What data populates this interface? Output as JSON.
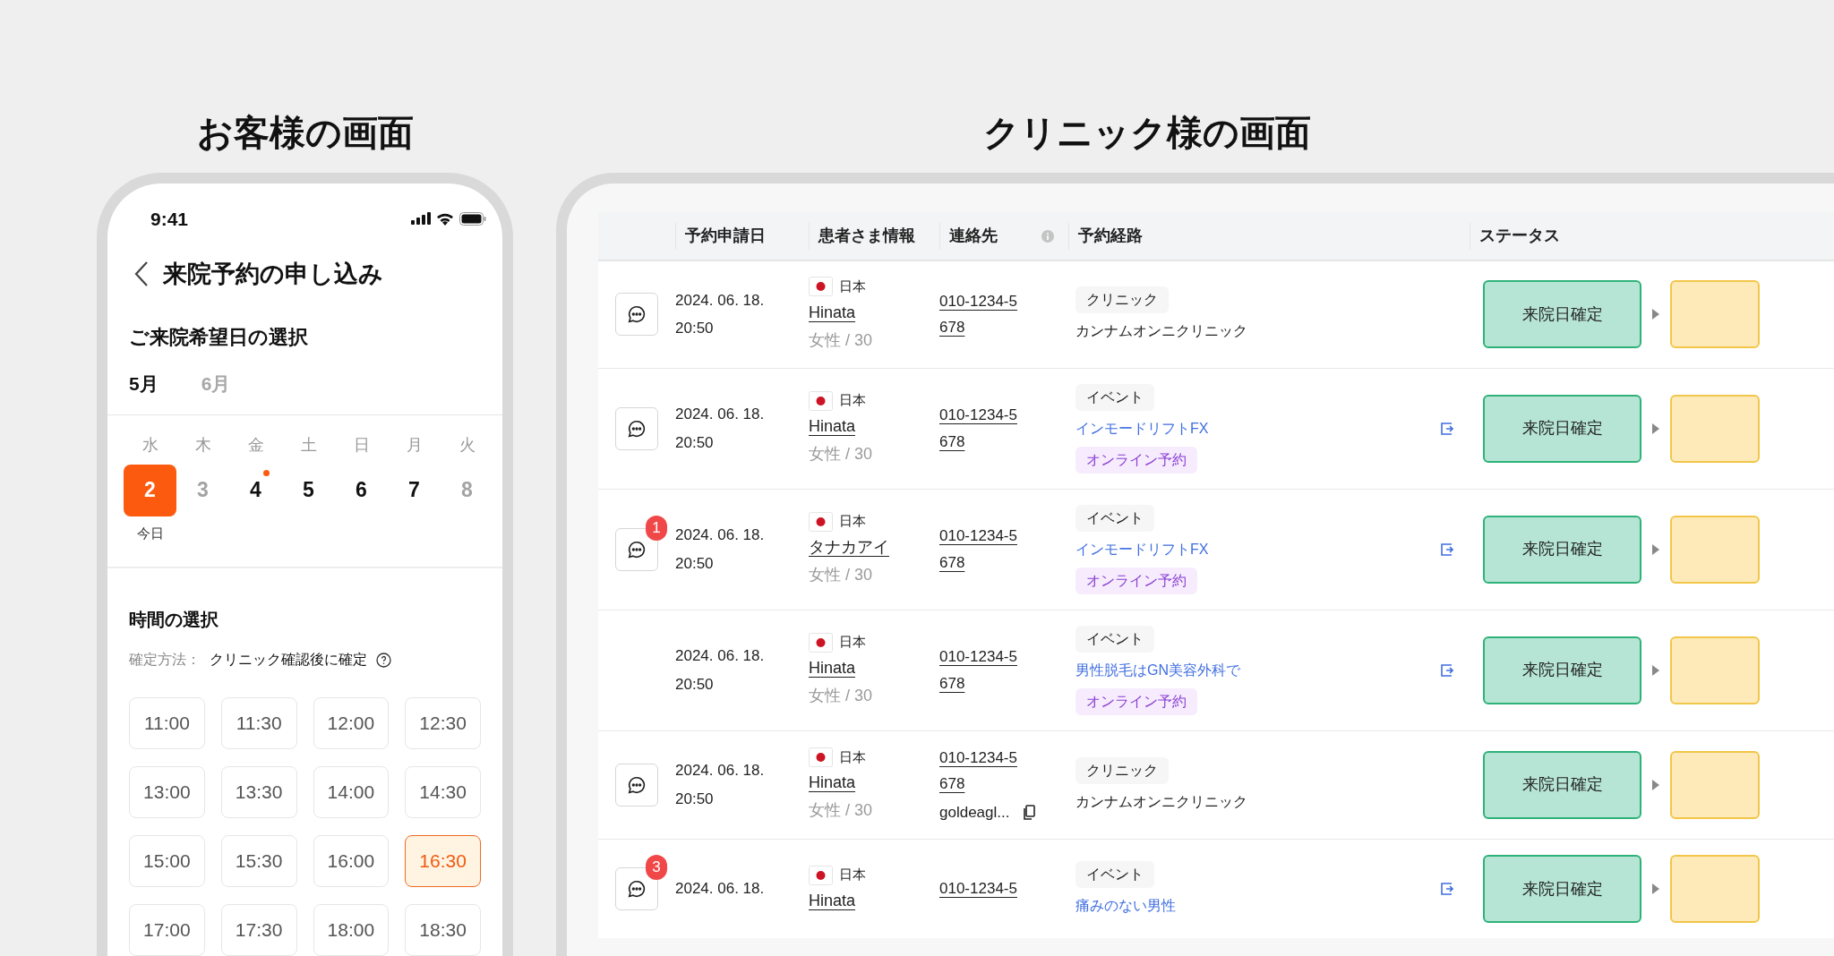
{
  "customer_screen": {
    "heading": "お客様の画面",
    "phone": {
      "status_time": "9:41",
      "title": "来院予約の申し込み",
      "date_section": {
        "title": "ご来院希望日の選択",
        "months": [
          {
            "label": "5月",
            "selected": true
          },
          {
            "label": "6月",
            "selected": false
          }
        ],
        "today_label": "今日",
        "days": [
          {
            "weekday": "水",
            "date": "2",
            "available": true,
            "selected": true,
            "dot": false
          },
          {
            "weekday": "木",
            "date": "3",
            "available": false,
            "selected": false,
            "dot": false
          },
          {
            "weekday": "金",
            "date": "4",
            "available": true,
            "selected": false,
            "dot": true
          },
          {
            "weekday": "土",
            "date": "5",
            "available": true,
            "selected": false,
            "dot": false
          },
          {
            "weekday": "日",
            "date": "6",
            "available": true,
            "selected": false,
            "dot": false
          },
          {
            "weekday": "月",
            "date": "7",
            "available": true,
            "selected": false,
            "dot": false
          },
          {
            "weekday": "火",
            "date": "8",
            "available": false,
            "selected": false,
            "dot": false
          }
        ]
      },
      "time_section": {
        "title": "時間の選択",
        "method_label": "確定方法：",
        "method_value": "クリニック確認後に確定",
        "slots": [
          {
            "label": "11:00",
            "selected": false
          },
          {
            "label": "11:30",
            "selected": false
          },
          {
            "label": "12:00",
            "selected": false
          },
          {
            "label": "12:30",
            "selected": false
          },
          {
            "label": "13:00",
            "selected": false
          },
          {
            "label": "13:30",
            "selected": false
          },
          {
            "label": "14:00",
            "selected": false
          },
          {
            "label": "14:30",
            "selected": false
          },
          {
            "label": "15:00",
            "selected": false
          },
          {
            "label": "15:30",
            "selected": false
          },
          {
            "label": "16:00",
            "selected": false
          },
          {
            "label": "16:30",
            "selected": true
          },
          {
            "label": "17:00",
            "selected": false
          },
          {
            "label": "17:30",
            "selected": false
          },
          {
            "label": "18:00",
            "selected": false
          },
          {
            "label": "18:30",
            "selected": false
          }
        ]
      }
    }
  },
  "clinic_screen": {
    "heading": "クリニック様の画面",
    "table": {
      "columns": [
        "予約申請日",
        "患者さま情報",
        "連絡先",
        "予約経路",
        "ステータス"
      ],
      "rows": [
        {
          "chat": true,
          "date": "2024. 06. 18.",
          "time": "20:50",
          "country": "日本",
          "name": "Hinata",
          "gender_age": "女性 / 30",
          "phone_1": "010-1234-5",
          "phone_2": "678",
          "route_type": "クリニック",
          "kind": "clinic",
          "route_name": "カンナムオンニクリニック",
          "status": "来院日確定"
        },
        {
          "chat": true,
          "date": "2024. 06. 18.",
          "time": "20:50",
          "country": "日本",
          "name": "Hinata",
          "gender_age": "女性 / 30",
          "phone_1": "010-1234-5",
          "phone_2": "678",
          "route_type": "イベント",
          "kind": "event",
          "route_name": "インモードリフトFX",
          "tag": "オンライン予約",
          "status": "来院日確定"
        },
        {
          "chat": true,
          "unread": "1",
          "date": "2024. 06. 18.",
          "time": "20:50",
          "country": "日本",
          "name": "タナカアイ",
          "gender_age": "女性 / 30",
          "phone_1": "010-1234-5",
          "phone_2": "678",
          "route_type": "イベント",
          "kind": "event",
          "route_name": "インモードリフトFX",
          "tag": "オンライン予約",
          "status": "来院日確定"
        },
        {
          "chat": false,
          "date": "2024. 06. 18.",
          "time": "20:50",
          "country": "日本",
          "name": "Hinata",
          "gender_age": "女性 / 30",
          "phone_1": "010-1234-5",
          "phone_2": "678",
          "route_type": "イベント",
          "kind": "event",
          "route_name": "男性脱毛はGN美容外科で",
          "tag": "オンライン予約",
          "status": "来院日確定"
        },
        {
          "chat": true,
          "date": "2024. 06. 18.",
          "time": "20:50",
          "country": "日本",
          "name": "Hinata",
          "gender_age": "女性 / 30",
          "phone_1": "010-1234-5",
          "phone_2": "678",
          "email": "goldeagl...",
          "route_type": "クリニック",
          "kind": "clinic",
          "route_name": "カンナムオンニクリニック",
          "status": "来院日確定"
        },
        {
          "chat": true,
          "unread": "3",
          "date": "2024. 06. 18.",
          "country": "日本",
          "name": "Hinata",
          "phone_1": "010-1234-5",
          "route_type": "イベント",
          "kind": "event",
          "route_name": "痛みのない男性",
          "status": "来院日確定"
        }
      ]
    }
  }
}
